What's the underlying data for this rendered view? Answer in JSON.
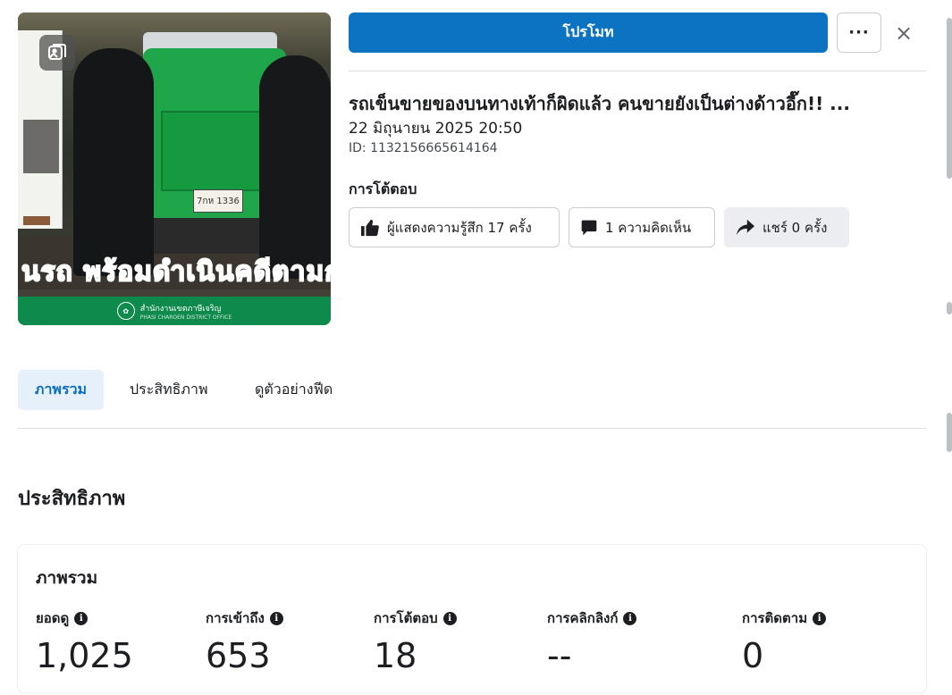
{
  "thumbnail": {
    "banner_text": "นรถ พร้อมดำเนินคดีตามกฎห",
    "plate_text": "7กห 1336",
    "footer_text": "สำนักงานเขตภาษีเจริญ",
    "footer_subtext": "PHASI CHAROEN DISTRICT OFFICE",
    "icon": "gallery-icon"
  },
  "header": {
    "promote_label": "โปรโมท",
    "more_label": "···",
    "close_label": "×"
  },
  "post": {
    "title": "รถเข็นขายของบนทางเท้าก็ผิดแล้ว คนขายยังเป็นต่างด้าวอี๊ก!! ...",
    "date": "22 มิถุนายน 2025 20:50",
    "id": "ID: 1132156665614164"
  },
  "engagement": {
    "label": "การโต้ตอบ",
    "reactions": "ผู้แสดงความรู้สึก 17 ครั้ง",
    "comments": "1 ความคิดเห็น",
    "shares": "แชร์ 0 ครั้ง"
  },
  "tabs": {
    "overview": "ภาพรวม",
    "performance": "ประสิทธิภาพ",
    "feed_preview": "ดูตัวอย่างฟีด"
  },
  "performance": {
    "section_title": "ประสิทธิภาพ",
    "card_title": "ภาพรวม",
    "metrics": [
      {
        "label": "ยอดดู",
        "value": "1,025"
      },
      {
        "label": "การเข้าถึง",
        "value": "653"
      },
      {
        "label": "การโต้ตอบ",
        "value": "18"
      },
      {
        "label": "การคลิกลิงก์",
        "value": "--"
      },
      {
        "label": "การติดตาม",
        "value": "0"
      }
    ]
  },
  "colors": {
    "primary": "#0b73c2",
    "tab_active_bg": "#e6f0fa",
    "tab_active_text": "#0b6fc0"
  }
}
